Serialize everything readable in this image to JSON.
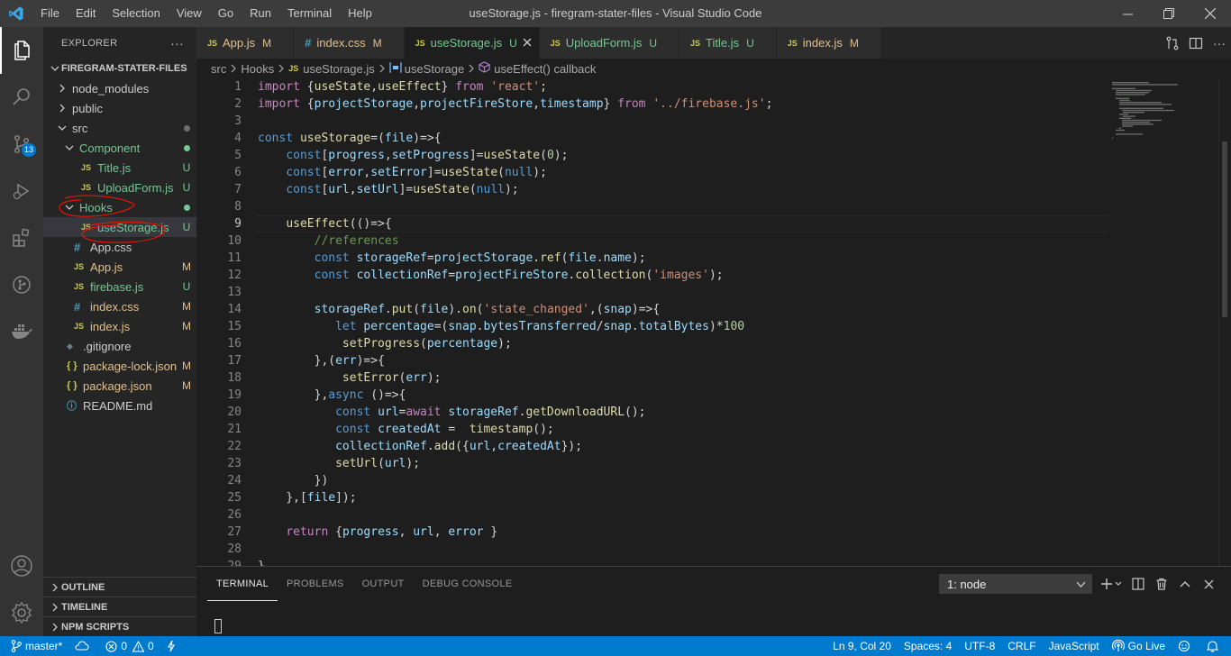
{
  "window": {
    "title": "useStorage.js - firegram-stater-files - Visual Studio Code",
    "menu": [
      "File",
      "Edit",
      "Selection",
      "View",
      "Go",
      "Run",
      "Terminal",
      "Help"
    ]
  },
  "activity_bar": {
    "items": [
      {
        "name": "explorer",
        "active": true
      },
      {
        "name": "search"
      },
      {
        "name": "source-control",
        "badge": "13"
      },
      {
        "name": "run-debug"
      },
      {
        "name": "extensions"
      },
      {
        "name": "git-graph"
      },
      {
        "name": "docker"
      }
    ],
    "bottom": [
      {
        "name": "accounts"
      },
      {
        "name": "manage"
      }
    ]
  },
  "sidebar": {
    "header": "EXPLORER",
    "header_actions": "···",
    "root": "FIREGRAM-STATER-FILES",
    "tree": [
      {
        "name": "node_modules",
        "type": "folder",
        "collapsed": true,
        "depth": 0,
        "color": "#cccccc"
      },
      {
        "name": "public",
        "type": "folder",
        "collapsed": true,
        "depth": 0,
        "color": "#cccccc"
      },
      {
        "name": "src",
        "type": "folder",
        "collapsed": false,
        "depth": 0,
        "color": "#cccccc",
        "dot": "#6f6f6f"
      },
      {
        "name": "Component",
        "type": "folder",
        "collapsed": false,
        "depth": 1,
        "color": "#73c991",
        "dot": "#73c991"
      },
      {
        "name": "Title.js",
        "type": "js",
        "depth": 2,
        "color": "#73c991",
        "status": "U"
      },
      {
        "name": "UploadForm.js",
        "type": "js",
        "depth": 2,
        "color": "#73c991",
        "status": "U"
      },
      {
        "name": "Hooks",
        "type": "folder",
        "collapsed": false,
        "depth": 1,
        "color": "#73c991",
        "dot": "#73c991"
      },
      {
        "name": "useStorage.js",
        "type": "js",
        "depth": 2,
        "color": "#73c991",
        "status": "U",
        "selected": true
      },
      {
        "name": "App.css",
        "type": "css",
        "depth": 1,
        "color": "#cccccc"
      },
      {
        "name": "App.js",
        "type": "js",
        "depth": 1,
        "color": "#e2c08d",
        "status": "M"
      },
      {
        "name": "firebase.js",
        "type": "js",
        "depth": 1,
        "color": "#73c991",
        "status": "U"
      },
      {
        "name": "index.css",
        "type": "css",
        "depth": 1,
        "color": "#e2c08d",
        "status": "M"
      },
      {
        "name": "index.js",
        "type": "js",
        "depth": 1,
        "color": "#e2c08d",
        "status": "M"
      },
      {
        "name": ".gitignore",
        "type": "git",
        "depth": 0,
        "color": "#cccccc"
      },
      {
        "name": "package-lock.json",
        "type": "json",
        "depth": 0,
        "color": "#e2c08d",
        "status": "M"
      },
      {
        "name": "package.json",
        "type": "json",
        "depth": 0,
        "color": "#e2c08d",
        "status": "M"
      },
      {
        "name": "README.md",
        "type": "info",
        "depth": 0,
        "color": "#cccccc"
      }
    ],
    "bottom_sections": [
      "OUTLINE",
      "TIMELINE",
      "NPM SCRIPTS"
    ]
  },
  "tabs": [
    {
      "label": "App.js",
      "type": "js",
      "status": "M",
      "color": "#e2c08d"
    },
    {
      "label": "index.css",
      "type": "css",
      "status": "M",
      "color": "#e2c08d"
    },
    {
      "label": "useStorage.js",
      "type": "js",
      "status": "U",
      "color": "#73c991",
      "active": true
    },
    {
      "label": "UploadForm.js",
      "type": "js",
      "status": "U",
      "color": "#73c991"
    },
    {
      "label": "Title.js",
      "type": "js",
      "status": "U",
      "color": "#73c991"
    },
    {
      "label": "index.js",
      "type": "js",
      "status": "M",
      "color": "#e2c08d"
    }
  ],
  "breadcrumb": {
    "parts": [
      "src",
      "Hooks",
      "useStorage.js",
      "useStorage",
      "useEffect() callback"
    ]
  },
  "editor": {
    "current_line": 9,
    "lines": [
      "import {useState,useEffect} from 'react';",
      "import {projectStorage,projectFireStore,timestamp} from '../firebase.js';",
      "",
      "const useStorage=(file)=>{",
      "    const[progress,setProgress]=useState(0);",
      "    const[error,setError]=useState(null);",
      "    const[url,setUrl]=useState(null);",
      "",
      "    useEffect(()=>{",
      "        //references",
      "        const storageRef=projectStorage.ref(file.name);",
      "        const collectionRef=projectFireStore.collection('images');",
      "",
      "        storageRef.put(file).on('state_changed',(snap)=>{",
      "           let percentage=(snap.bytesTransferred/snap.totalBytes)*100",
      "            setProgress(percentage);",
      "        },(err)=>{",
      "            setError(err);",
      "        },async ()=>{",
      "           const url=await storageRef.getDownloadURL();",
      "           const createdAt =  timestamp();",
      "           collectionRef.add({url,createdAt});",
      "           setUrl(url);",
      "        })",
      "    },[file]);",
      "",
      "    return {progress, url, error }",
      "",
      "}"
    ]
  },
  "panel": {
    "tabs": [
      "TERMINAL",
      "PROBLEMS",
      "OUTPUT",
      "DEBUG CONSOLE"
    ],
    "active_tab": "TERMINAL",
    "terminal_select": "1: node"
  },
  "statusbar": {
    "branch": "master*",
    "errors": "0",
    "warnings": "0",
    "position": "Ln 9, Col 20",
    "spaces": "Spaces: 4",
    "encoding": "UTF-8",
    "eol": "CRLF",
    "language": "JavaScript",
    "go_live": "Go Live"
  },
  "colors": {
    "accent": "#007acc",
    "untracked": "#73c991",
    "modified": "#e2c08d",
    "js_icon": "#cbcb41",
    "css_icon": "#519aba",
    "json_icon": "#cbcb41",
    "annotation": "#e51400"
  }
}
